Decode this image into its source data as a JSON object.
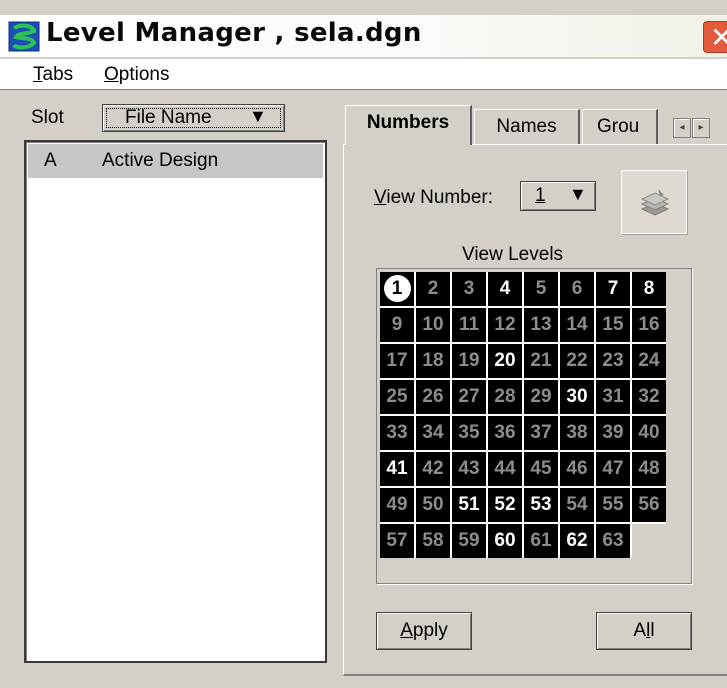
{
  "window": {
    "title": "Level Manager , sela.dgn",
    "close_symbol": "✕",
    "title_icon": "level-manager-icon"
  },
  "menu": {
    "items": [
      {
        "label": "Tabs",
        "mnemonic": "T",
        "rest": "abs"
      },
      {
        "label": "Options",
        "mnemonic": "O",
        "rest": "ptions"
      }
    ]
  },
  "left": {
    "slot_label": "Slot",
    "column_select": "File Name",
    "files": [
      {
        "slot": "A",
        "name": "Active Design"
      }
    ]
  },
  "tabs": {
    "items": [
      "Numbers",
      "Names",
      "Grou"
    ],
    "active": "Numbers",
    "scroll_left": "◂",
    "scroll_right": "▸"
  },
  "numbers": {
    "view_number_label": "View Number:",
    "view_number_mnemonic": "V",
    "view_number_rest": "iew Number:",
    "view_number_value": "1",
    "view_levels_label": "View Levels",
    "active_level": 1,
    "levels_on": [
      1,
      4,
      7,
      8,
      20,
      30,
      41,
      51,
      52,
      53,
      60,
      62
    ],
    "level_count": 63
  },
  "buttons": {
    "apply_mnemonic": "A",
    "apply_rest": "pply",
    "apply_label": "Apply",
    "all_pre": "A",
    "all_mnemonic": "l",
    "all_rest": "l",
    "all_label": "All"
  },
  "colors": {
    "title_close": "#e35a3d",
    "grid_bg": "#000000",
    "level_on": "#ffffff",
    "level_off": "#8c8c8c"
  }
}
